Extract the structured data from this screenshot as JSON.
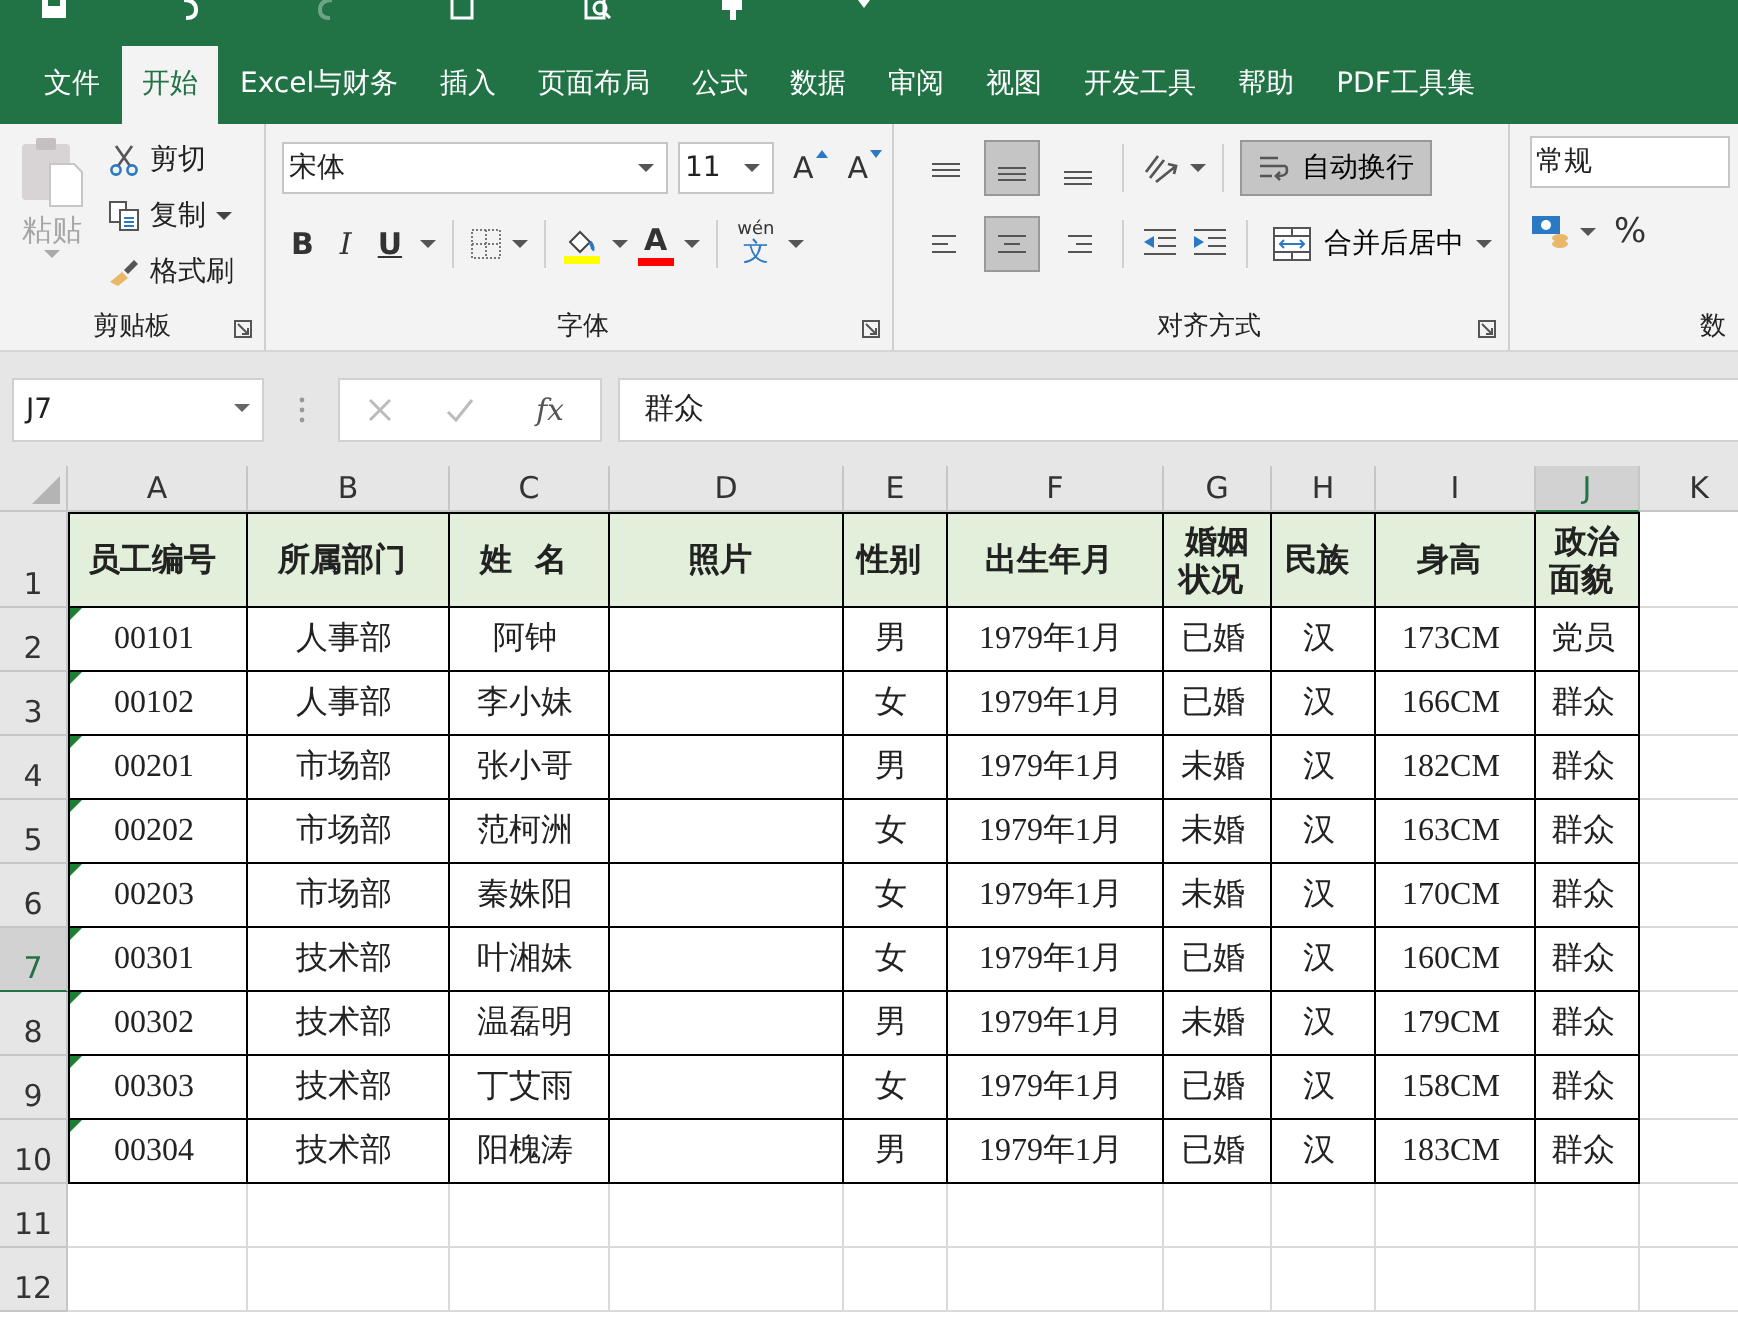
{
  "ribbon_tabs": [
    {
      "label": "文件",
      "selected": false
    },
    {
      "label": "开始",
      "selected": true
    },
    {
      "label": "Excel与财务",
      "selected": false
    },
    {
      "label": "插入",
      "selected": false
    },
    {
      "label": "页面布局",
      "selected": false
    },
    {
      "label": "公式",
      "selected": false
    },
    {
      "label": "数据",
      "selected": false
    },
    {
      "label": "审阅",
      "selected": false
    },
    {
      "label": "视图",
      "selected": false
    },
    {
      "label": "开发工具",
      "selected": false
    },
    {
      "label": "帮助",
      "selected": false
    },
    {
      "label": "PDF工具集",
      "selected": false
    }
  ],
  "ribbon": {
    "clipboard": {
      "paste": {
        "label": "粘贴",
        "disabled": true
      },
      "commands": [
        {
          "kind": "cut",
          "label": "剪切",
          "dropdown": false
        },
        {
          "kind": "copy",
          "label": "复制",
          "dropdown": true
        },
        {
          "kind": "painter",
          "label": "格式刷",
          "dropdown": false
        }
      ],
      "group_label": "剪贴板"
    },
    "font": {
      "font_name": "宋体",
      "font_size": "11",
      "size_buttons": [
        {
          "kind": "grow",
          "label": "A"
        },
        {
          "kind": "shrink",
          "label": "A"
        }
      ],
      "style_buttons": [
        {
          "kind": "bold",
          "label": "B"
        },
        {
          "kind": "italic",
          "label": "I"
        },
        {
          "kind": "underline",
          "label": "U"
        }
      ],
      "font_color_label": "A",
      "phonetic": {
        "pinyin": "wén",
        "character": "文"
      },
      "group_label": "字体"
    },
    "alignment": {
      "vertical": [
        {
          "kind": "top",
          "selected": false
        },
        {
          "kind": "middle",
          "selected": true
        },
        {
          "kind": "bottom",
          "selected": false
        }
      ],
      "horizontal": [
        {
          "kind": "left",
          "selected": false
        },
        {
          "kind": "center",
          "selected": true
        },
        {
          "kind": "right",
          "selected": false
        }
      ],
      "wrap_text": {
        "label": "自动换行",
        "on": true
      },
      "merge": {
        "label": "合并后居中"
      },
      "group_label": "对齐方式"
    },
    "number": {
      "format": "常规",
      "percent": "%",
      "group_label": "数"
    }
  },
  "formula_bar": {
    "name_box": "J7",
    "function_label": "fx",
    "formula": "群众"
  },
  "sheet": {
    "columns": [
      {
        "label": "A",
        "selected": false
      },
      {
        "label": "B",
        "selected": false
      },
      {
        "label": "C",
        "selected": false
      },
      {
        "label": "D",
        "selected": false
      },
      {
        "label": "E",
        "selected": false
      },
      {
        "label": "F",
        "selected": false
      },
      {
        "label": "G",
        "selected": false
      },
      {
        "label": "H",
        "selected": false
      },
      {
        "label": "I",
        "selected": false
      },
      {
        "label": "J",
        "selected": true
      },
      {
        "label": "K",
        "selected": false
      }
    ],
    "rows": [
      {
        "label": "1",
        "selected": false
      },
      {
        "label": "2",
        "selected": false
      },
      {
        "label": "3",
        "selected": false
      },
      {
        "label": "4",
        "selected": false
      },
      {
        "label": "5",
        "selected": false
      },
      {
        "label": "6",
        "selected": false
      },
      {
        "label": "7",
        "selected": true
      },
      {
        "label": "8",
        "selected": false
      },
      {
        "label": "9",
        "selected": false
      },
      {
        "label": "10",
        "selected": false
      },
      {
        "label": "11",
        "selected": false
      },
      {
        "label": "12",
        "selected": false
      }
    ],
    "header": [
      "员工编号",
      "所属部门",
      "姓  名",
      "照片",
      "性别",
      "出生年月",
      "婚姻状况",
      "民族",
      "身高",
      "政治面貌"
    ],
    "records": [
      {
        "id": "00101",
        "dept": "人事部",
        "name": "阿钟",
        "gender": "男",
        "birth": "1979年1月",
        "marital": "已婚",
        "ethnicity": "汉",
        "height": "173CM",
        "political": "党员",
        "flag": true
      },
      {
        "id": "00102",
        "dept": "人事部",
        "name": "李小妹",
        "gender": "女",
        "birth": "1979年1月",
        "marital": "已婚",
        "ethnicity": "汉",
        "height": "166CM",
        "political": "群众",
        "flag": true
      },
      {
        "id": "00201",
        "dept": "市场部",
        "name": "张小哥",
        "gender": "男",
        "birth": "1979年1月",
        "marital": "未婚",
        "ethnicity": "汉",
        "height": "182CM",
        "political": "群众",
        "flag": true
      },
      {
        "id": "00202",
        "dept": "市场部",
        "name": "范柯洲",
        "gender": "女",
        "birth": "1979年1月",
        "marital": "未婚",
        "ethnicity": "汉",
        "height": "163CM",
        "political": "群众",
        "flag": true
      },
      {
        "id": "00203",
        "dept": "市场部",
        "name": "秦姝阳",
        "gender": "女",
        "birth": "1979年1月",
        "marital": "未婚",
        "ethnicity": "汉",
        "height": "170CM",
        "political": "群众",
        "flag": true
      },
      {
        "id": "00301",
        "dept": "技术部",
        "name": "叶湘妹",
        "gender": "女",
        "birth": "1979年1月",
        "marital": "已婚",
        "ethnicity": "汉",
        "height": "160CM",
        "political": "群众",
        "flag": true
      },
      {
        "id": "00302",
        "dept": "技术部",
        "name": "温磊明",
        "gender": "男",
        "birth": "1979年1月",
        "marital": "未婚",
        "ethnicity": "汉",
        "height": "179CM",
        "political": "群众",
        "flag": true
      },
      {
        "id": "00303",
        "dept": "技术部",
        "name": "丁艾雨",
        "gender": "女",
        "birth": "1979年1月",
        "marital": "已婚",
        "ethnicity": "汉",
        "height": "158CM",
        "political": "群众",
        "flag": true
      },
      {
        "id": "00304",
        "dept": "技术部",
        "name": "阳槐涛",
        "gender": "男",
        "birth": "1979年1月",
        "marital": "已婚",
        "ethnicity": "汉",
        "height": "183CM",
        "political": "群众",
        "flag": true
      }
    ]
  }
}
